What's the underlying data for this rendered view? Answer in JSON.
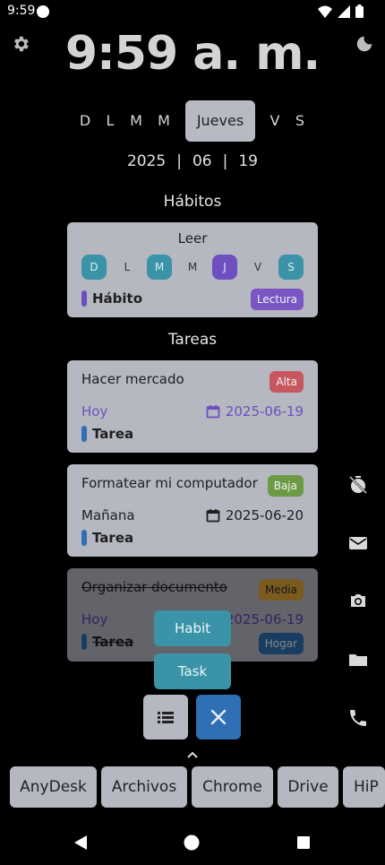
{
  "status_bar": {
    "time": "9:59"
  },
  "clock": {
    "time": "9:59 a. m."
  },
  "days": [
    "D",
    "L",
    "M",
    "M",
    "Jueves",
    "V",
    "S"
  ],
  "date": {
    "year": "2025",
    "month": "06",
    "day": "19",
    "separator": "|"
  },
  "sections": {
    "habits": "Hábitos",
    "tasks": "Tareas"
  },
  "habit_card": {
    "title": "Leer",
    "days": [
      "D",
      "L",
      "M",
      "M",
      "J",
      "V",
      "S"
    ],
    "type": "Hábito",
    "tag": "Lectura"
  },
  "tasks": [
    {
      "title": "Hacer mercado",
      "priority": "Alta",
      "when": "Hoy",
      "date": "2025-06-19",
      "type": "Tarea"
    },
    {
      "title": "Formatear mi computador",
      "priority": "Baja",
      "when": "Mañana",
      "date": "2025-06-20",
      "type": "Tarea"
    },
    {
      "title": "Organizar documento",
      "priority": "Media",
      "when": "Hoy",
      "date": "2025-06-19",
      "type": "Tarea",
      "tag": "Hogar"
    }
  ],
  "fab": {
    "habit": "Habit",
    "task": "Task"
  },
  "dock": [
    "AnyDesk",
    "Archivos",
    "Chrome",
    "Drive",
    "HiP"
  ],
  "icons": {
    "settings": "gear-icon",
    "theme": "moon-icon",
    "timer": "timer-off-icon",
    "mail": "mail-icon",
    "camera": "camera-icon",
    "folder": "folder-icon",
    "phone": "phone-icon",
    "calendar": "calendar-icon",
    "list": "list-icon",
    "close": "close-icon",
    "expand": "chevron-up-icon"
  },
  "colors": {
    "card": "#b5b7c1",
    "teal": "#3a93a6",
    "purple": "#6e4fbf",
    "alta": "#c8565f",
    "baja": "#6d9a45",
    "media": "#d3a24a",
    "hogar": "#2f6fb3",
    "task_bar": "#2f6fb3",
    "today": "#6e4fbf"
  }
}
